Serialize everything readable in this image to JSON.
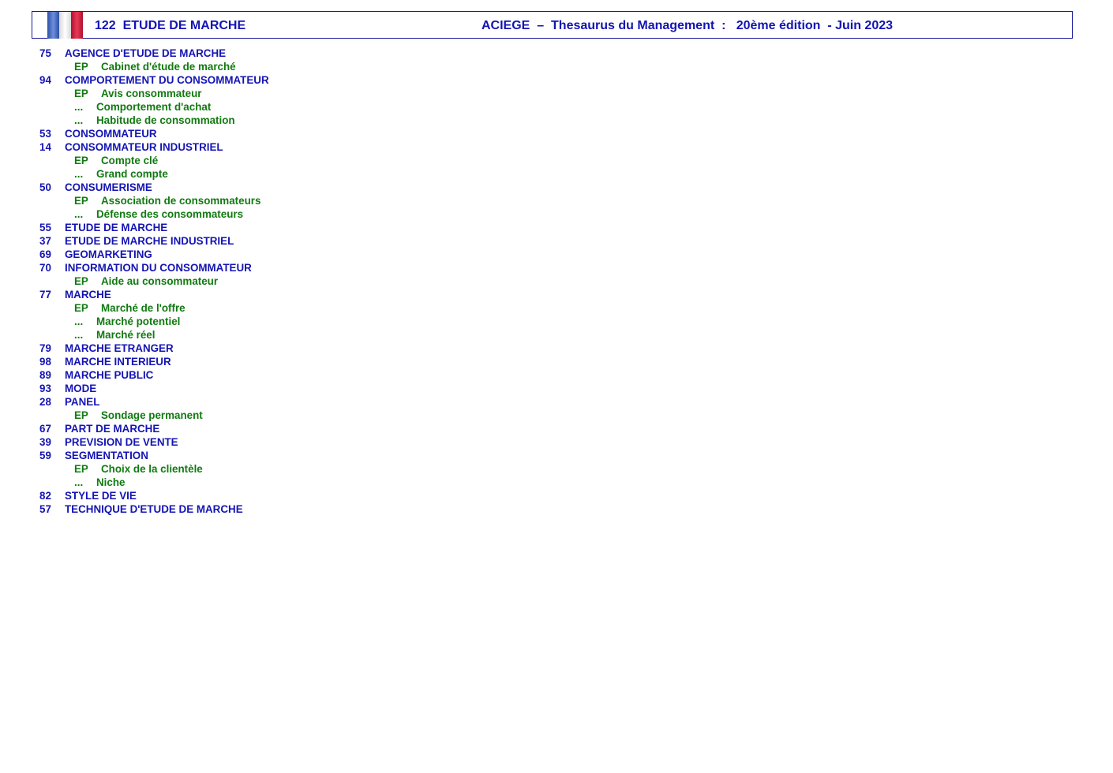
{
  "header": {
    "left": "122  ETUDE DE MARCHE",
    "right": "ACIEGE  –  Thesaurus du Management  :   20ème édition  - Juin 2023"
  },
  "rows": [
    {
      "type": "term",
      "num": "75",
      "label": "AGENCE D'ETUDE DE MARCHE"
    },
    {
      "type": "ep",
      "prefix": "EP",
      "label": "Cabinet d'étude de marché"
    },
    {
      "type": "term",
      "num": "94",
      "label": "COMPORTEMENT DU CONSOMMATEUR"
    },
    {
      "type": "ep",
      "prefix": "EP",
      "label": "Avis consommateur"
    },
    {
      "type": "dots",
      "prefix": "...",
      "label": "Comportement d'achat"
    },
    {
      "type": "dots",
      "prefix": "...",
      "label": "Habitude de consommation"
    },
    {
      "type": "term",
      "num": "53",
      "label": "CONSOMMATEUR"
    },
    {
      "type": "term",
      "num": "14",
      "label": "CONSOMMATEUR INDUSTRIEL"
    },
    {
      "type": "ep",
      "prefix": "EP",
      "label": "Compte clé"
    },
    {
      "type": "dots",
      "prefix": "...",
      "label": "Grand compte"
    },
    {
      "type": "term",
      "num": "50",
      "label": "CONSUMERISME"
    },
    {
      "type": "ep",
      "prefix": "EP",
      "label": "Association de consommateurs"
    },
    {
      "type": "dots",
      "prefix": "...",
      "label": "Défense des consommateurs"
    },
    {
      "type": "term",
      "num": "55",
      "label": "ETUDE DE MARCHE"
    },
    {
      "type": "term",
      "num": "37",
      "label": "ETUDE DE MARCHE INDUSTRIEL"
    },
    {
      "type": "term",
      "num": "69",
      "label": "GEOMARKETING"
    },
    {
      "type": "term",
      "num": "70",
      "label": "INFORMATION DU CONSOMMATEUR"
    },
    {
      "type": "ep",
      "prefix": "EP",
      "label": "Aide au consommateur"
    },
    {
      "type": "term",
      "num": "77",
      "label": "MARCHE"
    },
    {
      "type": "ep",
      "prefix": "EP",
      "label": "Marché de l'offre"
    },
    {
      "type": "dots",
      "prefix": "...",
      "label": "Marché potentiel"
    },
    {
      "type": "dots",
      "prefix": "...",
      "label": "Marché réel"
    },
    {
      "type": "term",
      "num": "79",
      "label": "MARCHE ETRANGER"
    },
    {
      "type": "term",
      "num": "98",
      "label": "MARCHE INTERIEUR"
    },
    {
      "type": "term",
      "num": "89",
      "label": "MARCHE PUBLIC"
    },
    {
      "type": "term",
      "num": "93",
      "label": "MODE"
    },
    {
      "type": "term",
      "num": "28",
      "label": "PANEL"
    },
    {
      "type": "ep",
      "prefix": "EP",
      "label": "Sondage permanent"
    },
    {
      "type": "term",
      "num": "67",
      "label": "PART DE MARCHE"
    },
    {
      "type": "term",
      "num": "39",
      "label": "PREVISION DE VENTE"
    },
    {
      "type": "term",
      "num": "59",
      "label": "SEGMENTATION"
    },
    {
      "type": "ep",
      "prefix": "EP",
      "label": "Choix de la clientèle"
    },
    {
      "type": "dots",
      "prefix": "...",
      "label": "Niche"
    },
    {
      "type": "term",
      "num": "82",
      "label": "STYLE DE VIE"
    },
    {
      "type": "term",
      "num": "57",
      "label": "TECHNIQUE D'ETUDE DE MARCHE"
    }
  ]
}
